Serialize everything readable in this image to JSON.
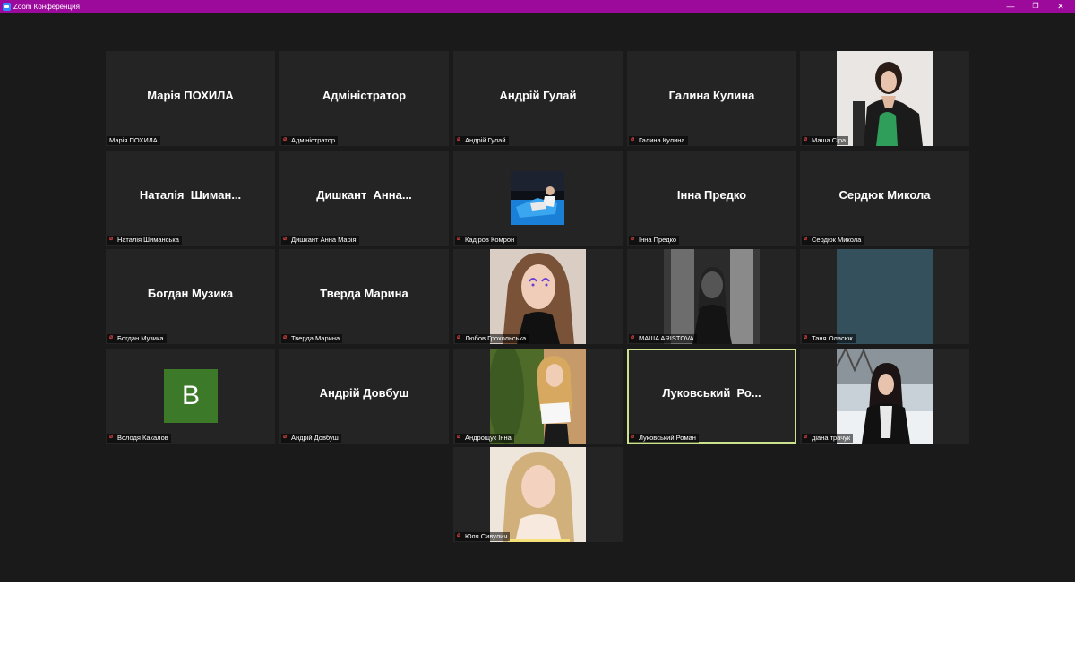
{
  "window": {
    "title": "Zoom Конференция",
    "controls": {
      "minimize": "—",
      "maximize": "❐",
      "close": "✕"
    }
  },
  "participants": [
    {
      "name": "Марія ПОХИЛА",
      "display": "Марія ПОХИЛА",
      "muted": false
    },
    {
      "name": "Адміністратор",
      "display": "Адміністратор",
      "muted": true
    },
    {
      "name": "Андрій Гулай",
      "display": "Андрій Гулай",
      "muted": true
    },
    {
      "name": "Галина Кулина",
      "display": "Галина Кулина",
      "muted": true
    },
    {
      "name": "Маша Сіра",
      "display": "",
      "muted": true,
      "video": true
    },
    {
      "name": "Наталія Шиманська",
      "display": "Наталія  Шиман...",
      "muted": true
    },
    {
      "name": "Дишкант Анна Марія",
      "display": "Дишкант  Анна...",
      "muted": true
    },
    {
      "name": "Кадіров Комрон",
      "display": "",
      "muted": true,
      "video": true
    },
    {
      "name": "Інна Предко",
      "display": "Інна Предко",
      "muted": true
    },
    {
      "name": "Сердюк Микола",
      "display": "Сердюк Микола",
      "muted": true
    },
    {
      "name": "Богдан Музика",
      "display": "Богдан Музика",
      "muted": true
    },
    {
      "name": "Тверда Марина",
      "display": "Тверда Марина",
      "muted": true
    },
    {
      "name": "Любов Грохольська",
      "display": "",
      "muted": true,
      "video": true
    },
    {
      "name": "MAШA ARISTOVA",
      "display": "",
      "muted": true,
      "video": true
    },
    {
      "name": "Таня Оласюк",
      "display": "",
      "muted": true,
      "video": true
    },
    {
      "name": "Володя Какалов",
      "display": "",
      "muted": true,
      "avatar_letter": "B",
      "avatar_color": "#3c7a2a"
    },
    {
      "name": "Андрій Довбуш",
      "display": "Андрій Довбуш",
      "muted": true
    },
    {
      "name": "Андрощук Інна",
      "display": "",
      "muted": true,
      "video": true
    },
    {
      "name": "Луковський Роман",
      "display": "Луковський  Ро...",
      "muted": true,
      "active_speaker": true
    },
    {
      "name": "діана трачук",
      "display": "",
      "muted": true,
      "video": true
    },
    {
      "name": "Юля Сивулич",
      "display": "",
      "muted": true,
      "video": true
    }
  ],
  "colors": {
    "titlebar": "#9c0a9c",
    "stage": "#1a1a1a",
    "tile": "#242424",
    "active_speaker_border": "#cde28c",
    "mute_icon": "#ff4b4b"
  }
}
